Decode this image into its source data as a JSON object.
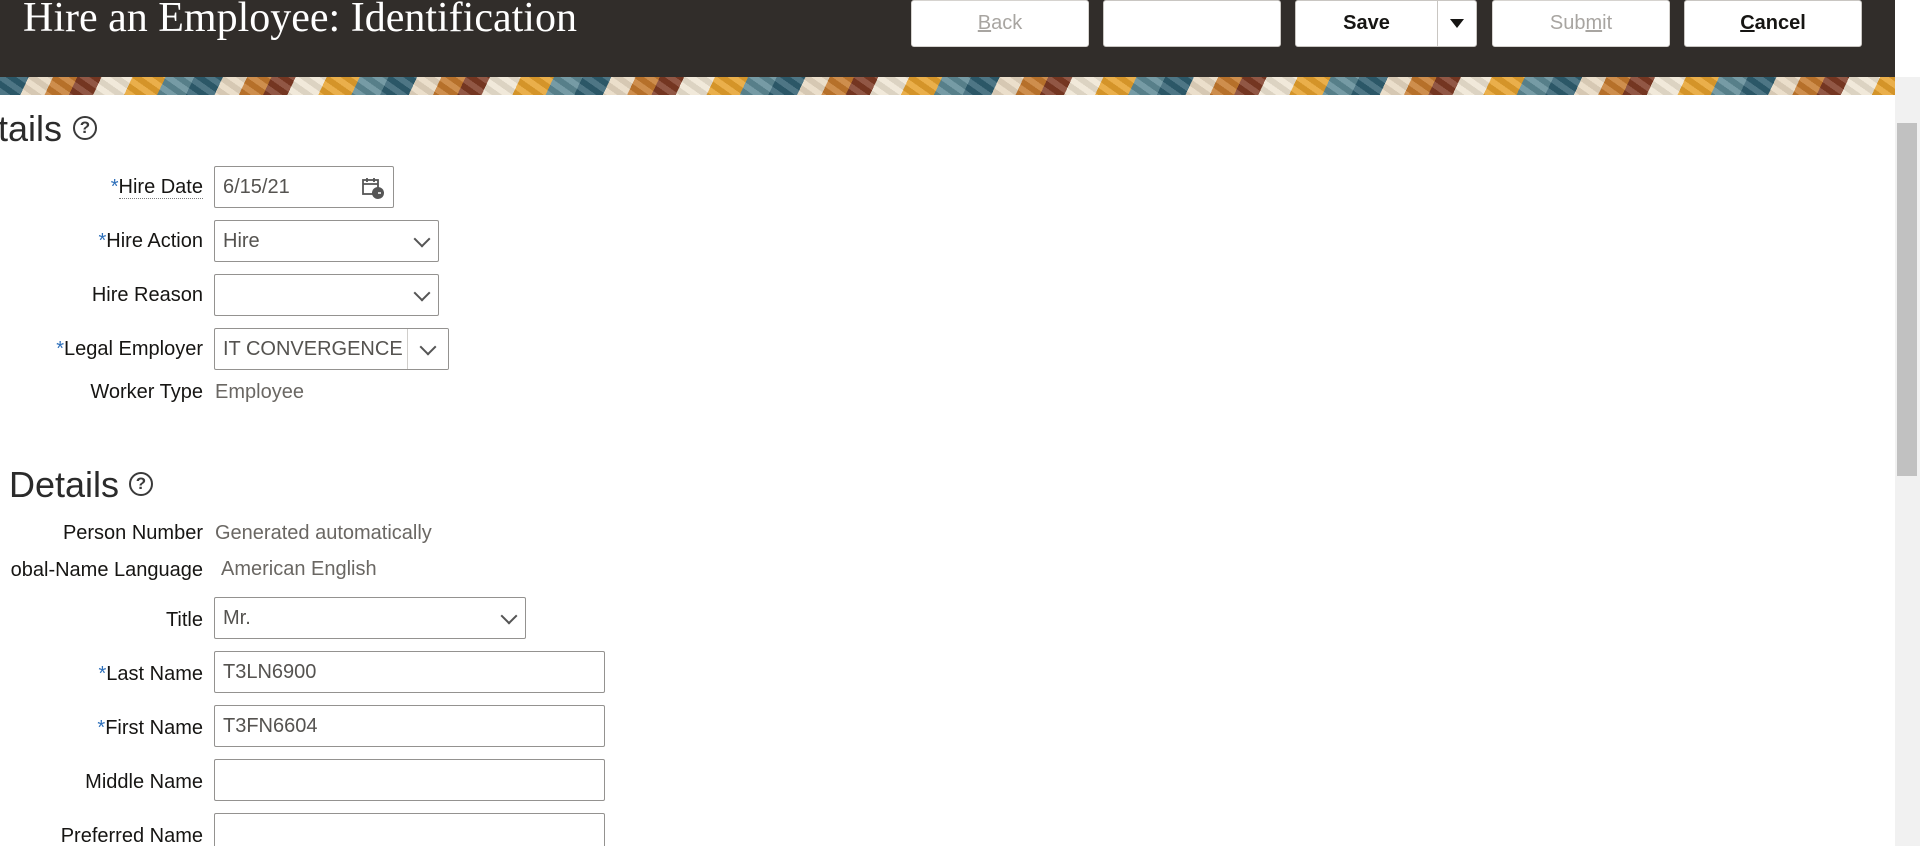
{
  "header": {
    "title": "Hire an Employee: Identification",
    "buttons": {
      "back": {
        "label_pre": "",
        "label_ul": "B",
        "label_post": "ack"
      },
      "blank": "",
      "save": "Save",
      "submit": {
        "label_pre": "Sub",
        "label_ul": "m",
        "label_post": "it"
      },
      "cancel": {
        "label_pre": "",
        "label_ul": "C",
        "label_post": "ancel"
      }
    }
  },
  "when_and_why": {
    "title": "tails",
    "fields": {
      "hire_date": {
        "label": "Hire Date",
        "value": "6/15/21"
      },
      "hire_action": {
        "label": "Hire Action",
        "value": "Hire"
      },
      "hire_reason": {
        "label": "Hire Reason",
        "value": ""
      },
      "legal_employer": {
        "label": "Legal Employer",
        "value": "IT CONVERGENCE"
      },
      "worker_type": {
        "label": "Worker Type",
        "value": "Employee"
      }
    }
  },
  "personal_details": {
    "title": "Details",
    "fields": {
      "person_number": {
        "label": "Person Number",
        "value": "Generated automatically"
      },
      "global_name_language": {
        "label": "obal-Name Language",
        "value": "American English"
      },
      "title": {
        "label": "Title",
        "value": "Mr."
      },
      "last_name": {
        "label": "Last Name",
        "value": "T3LN6900"
      },
      "first_name": {
        "label": "First Name",
        "value": "T3FN6604"
      },
      "middle_name": {
        "label": "Middle Name",
        "value": ""
      },
      "preferred_name": {
        "label": "Preferred Name",
        "value": ""
      }
    }
  },
  "required_marker": "*"
}
